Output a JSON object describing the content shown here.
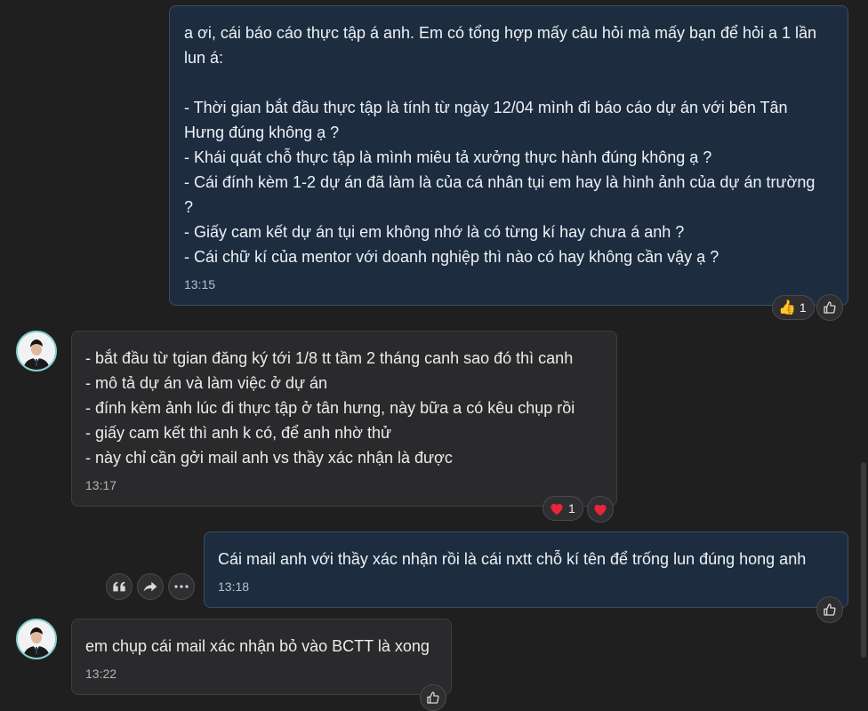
{
  "messages": [
    {
      "id": "m1",
      "lines": [
        "a ơi, cái báo cáo thực tập á anh. Em có tổng hợp mấy câu hỏi mà mấy bạn để hỏi a 1 lần",
        "lun á:",
        "",
        "- Thời gian bắt đầu thực tập là tính từ ngày 12/04 mình đi báo cáo dự án với bên Tân",
        "Hưng đúng không ạ ?",
        "- Khái quát chỗ thực tập là mình miêu tả xưởng thực hành đúng không ạ ?",
        "- Cái đính kèm 1-2 dự án đã làm là của cá nhân tụi em hay là hình ảnh của dự án trường",
        "?",
        "- Giấy cam kết dự án tụi em không nhớ là có từng kí hay chưa á anh ?",
        "- Cái chữ kí của mentor với doanh nghiệp thì nào có hay không cần vậy ạ ?"
      ],
      "time": "13:15",
      "reaction": {
        "emoji": "👍",
        "count": "1"
      }
    },
    {
      "id": "m2",
      "lines": [
        "-  bắt đầu từ tgian đăng ký tới 1/8 tt tầm 2 tháng canh sao đó thì canh",
        "- mô tả dự án và làm việc ở dự án",
        "- đính kèm ảnh lúc đi thực tập ở tân hưng, này bữa a có kêu chụp rồi",
        "- giấy cam kết thì anh k có, để anh nhờ thử",
        "- này chỉ cần gởi mail anh vs thầy xác nhận là được"
      ],
      "time": "13:17",
      "reaction": {
        "emoji": "❤️",
        "count": "1"
      }
    },
    {
      "id": "m3",
      "lines": [
        "Cái mail anh với thầy xác nhận rồi là cái nxtt chỗ kí tên để trống lun đúng hong anh"
      ],
      "time": "13:18"
    },
    {
      "id": "m4",
      "lines": [
        "em chụp cái mail xác nhận bỏ vào BCTT là xong"
      ],
      "time": "13:22"
    }
  ],
  "icons": {
    "thumbs_up_outline": "thumbs-up-icon",
    "quote": "quote-icon",
    "forward": "forward-icon",
    "more": "more-icon",
    "heart": "heart-icon"
  },
  "colors": {
    "background": "#1f1f1f",
    "outgoing_bubble": "#1e2c40",
    "incoming_bubble": "#2a2a2c",
    "avatar_ring": "#7ecfd0"
  }
}
